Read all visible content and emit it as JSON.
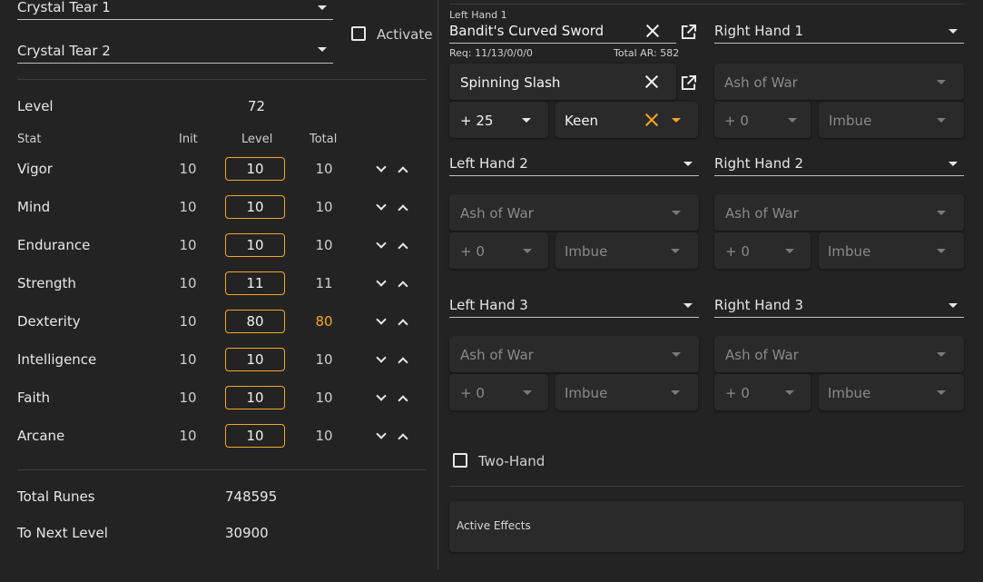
{
  "left": {
    "talisman1": "Crystal Tear 1",
    "talisman2": "Crystal Tear 2",
    "activate_label": "Activate",
    "level_label": "Level",
    "level_value": "72",
    "headers": {
      "stat": "Stat",
      "init": "Init",
      "level": "Level",
      "total": "Total"
    },
    "stats": [
      {
        "name": "Vigor",
        "init": "10",
        "level": "10",
        "total": "10"
      },
      {
        "name": "Mind",
        "init": "10",
        "level": "10",
        "total": "10"
      },
      {
        "name": "Endurance",
        "init": "10",
        "level": "10",
        "total": "10"
      },
      {
        "name": "Strength",
        "init": "10",
        "level": "11",
        "total": "11"
      },
      {
        "name": "Dexterity",
        "init": "10",
        "level": "80",
        "total": "80"
      },
      {
        "name": "Intelligence",
        "init": "10",
        "level": "10",
        "total": "10"
      },
      {
        "name": "Faith",
        "init": "10",
        "level": "10",
        "total": "10"
      },
      {
        "name": "Arcane",
        "init": "10",
        "level": "10",
        "total": "10"
      }
    ],
    "total_runes_label": "Total Runes",
    "total_runes_value": "748595",
    "next_level_label": "To Next Level",
    "next_level_value": "30900"
  },
  "right": {
    "lh1": {
      "caption": "Left Hand 1",
      "weapon": "Bandit's Curved Sword",
      "req": "Req: 11/13/0/0/0",
      "ar": "Total AR: 582",
      "ash": "Spinning Slash",
      "upgrade": "+ 25",
      "affinity": "Keen"
    },
    "rh1": {
      "label": "Right Hand 1",
      "ash": "Ash of War",
      "upgrade": "+ 0",
      "affinity": "Imbue"
    },
    "lh2": {
      "label": "Left Hand 2",
      "ash": "Ash of War",
      "upgrade": "+ 0",
      "affinity": "Imbue"
    },
    "rh2": {
      "label": "Right Hand 2",
      "ash": "Ash of War",
      "upgrade": "+ 0",
      "affinity": "Imbue"
    },
    "lh3": {
      "label": "Left Hand 3",
      "ash": "Ash of War",
      "upgrade": "+ 0",
      "affinity": "Imbue"
    },
    "rh3": {
      "label": "Right Hand 3",
      "ash": "Ash of War",
      "upgrade": "+ 0",
      "affinity": "Imbue"
    },
    "two_hand_label": "Two-Hand",
    "active_effects_label": "Active Effects"
  },
  "colors": {
    "accent": "#f5a623",
    "background": "#232323",
    "panel": "#2a2a2a"
  }
}
